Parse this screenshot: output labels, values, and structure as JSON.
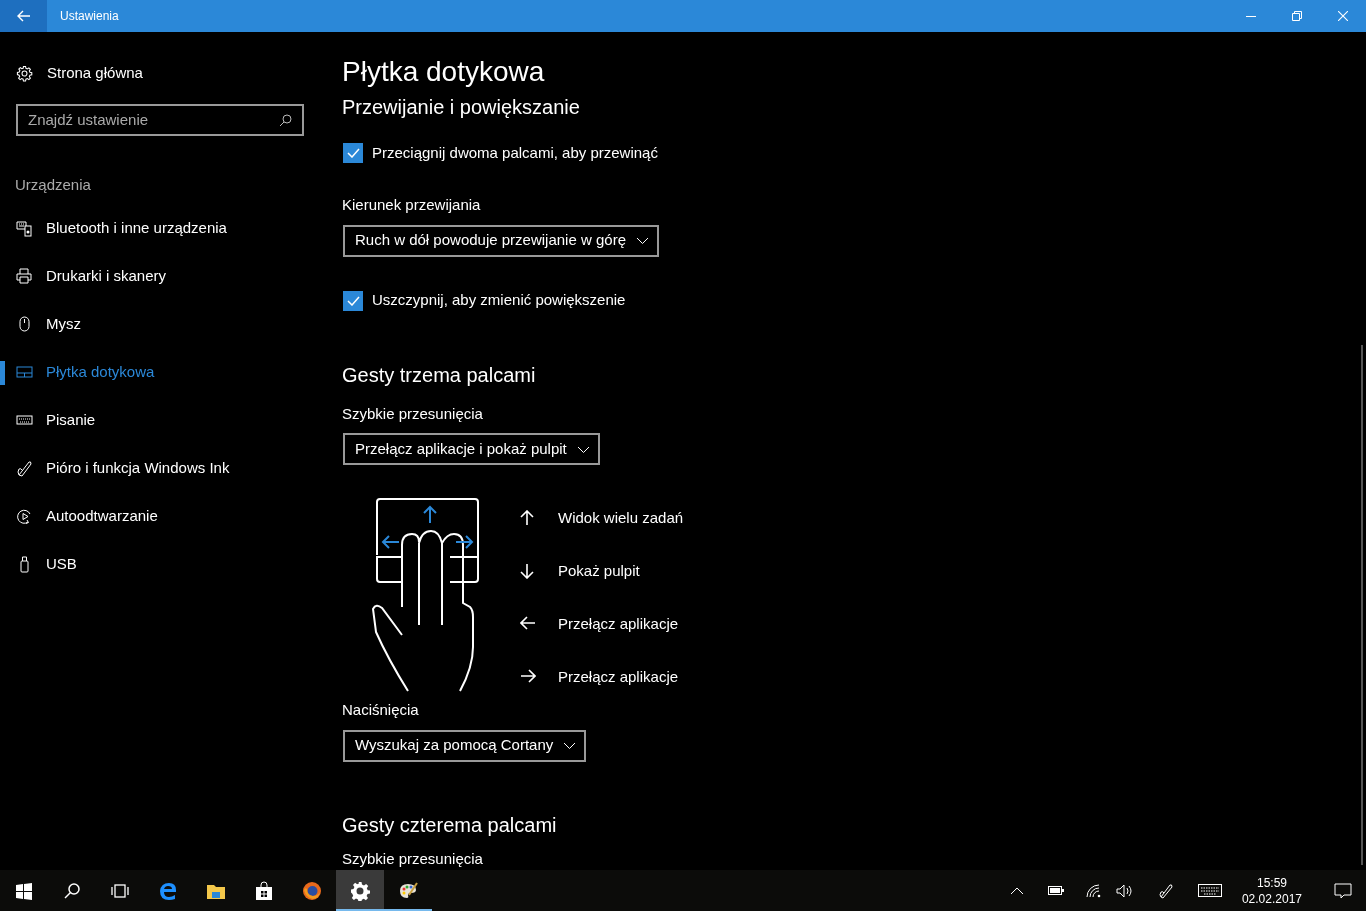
{
  "window": {
    "title": "Ustawienia"
  },
  "sidebar": {
    "home": "Strona główna",
    "search": {
      "placeholder": "Znajdź ustawienie"
    },
    "group": "Urządzenia",
    "items": [
      {
        "kind": "bluetooth",
        "label": "Bluetooth i inne urządzenia",
        "selected": false
      },
      {
        "kind": "printer",
        "label": "Drukarki i skanery",
        "selected": false
      },
      {
        "kind": "mouse",
        "label": "Mysz",
        "selected": false
      },
      {
        "kind": "touchpad",
        "label": "Płytka dotykowa",
        "selected": true
      },
      {
        "kind": "keyboard",
        "label": "Pisanie",
        "selected": false
      },
      {
        "kind": "pen",
        "label": "Pióro i funkcja Windows Ink",
        "selected": false
      },
      {
        "kind": "autoplay",
        "label": "Autoodtwarzanie",
        "selected": false
      },
      {
        "kind": "usb",
        "label": "USB",
        "selected": false
      }
    ]
  },
  "page": {
    "title": "Płytka dotykowa",
    "scroll_zoom": {
      "heading": "Przewijanie i powiększanie",
      "two_finger_scroll": {
        "label": "Przeciągnij dwoma palcami, aby przewinąć",
        "checked": true
      },
      "direction_label": "Kierunek przewijania",
      "direction_value": "Ruch w dół powoduje przewijanie w górę",
      "pinch_zoom": {
        "label": "Uszczypnij, aby zmienić powiększenie",
        "checked": true
      }
    },
    "three_finger": {
      "heading": "Gesty trzema palcami",
      "swipes_label": "Szybkie przesunięcia",
      "swipes_value": "Przełącz aplikacje i pokaż pulpit",
      "gestures": [
        {
          "kind": "up",
          "label": "Widok wielu zadań"
        },
        {
          "kind": "down",
          "label": "Pokaż pulpit"
        },
        {
          "kind": "left",
          "label": "Przełącz aplikacje"
        },
        {
          "kind": "right",
          "label": "Przełącz aplikacje"
        }
      ],
      "taps_label": "Naciśnięcia",
      "taps_value": "Wyszukaj za pomocą Cortany"
    },
    "four_finger": {
      "heading": "Gesty czterema palcami",
      "swipes_label": "Szybkie przesunięcia"
    }
  },
  "taskbar": {
    "apps": [
      {
        "kind": "start",
        "running": false,
        "active": false
      },
      {
        "kind": "search",
        "running": false,
        "active": false
      },
      {
        "kind": "taskview",
        "running": false,
        "active": false
      },
      {
        "kind": "edge",
        "running": false,
        "active": false
      },
      {
        "kind": "explorer",
        "running": false,
        "active": false
      },
      {
        "kind": "store",
        "running": false,
        "active": false
      },
      {
        "kind": "firefox",
        "running": false,
        "active": false
      },
      {
        "kind": "settings",
        "running": true,
        "active": true
      },
      {
        "kind": "paint",
        "running": true,
        "active": false
      }
    ],
    "time": "15:59",
    "date": "02.02.2017"
  }
}
